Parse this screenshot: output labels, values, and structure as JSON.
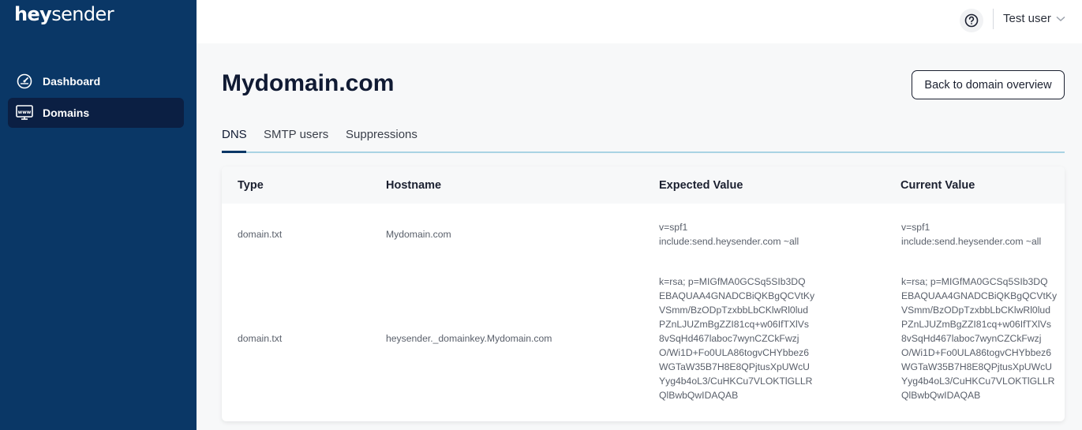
{
  "app": {
    "logo_bold": "hey",
    "logo_light": "sender"
  },
  "sidebar": {
    "items": [
      {
        "label": "Dashboard",
        "icon": "dashboard-gauge-icon",
        "active": false
      },
      {
        "label": "Domains",
        "icon": "domain-www-icon",
        "active": true
      }
    ]
  },
  "topbar": {
    "help_icon": "help-circle-icon",
    "user_name": "Test user",
    "user_chevron": "chevron-down-icon"
  },
  "page": {
    "title": "Mydomain.com",
    "back_button": "Back to domain overview"
  },
  "tabs": [
    {
      "label": "DNS",
      "active": true
    },
    {
      "label": "SMTP users",
      "active": false
    },
    {
      "label": "Suppressions",
      "active": false
    }
  ],
  "table": {
    "columns": [
      "Type",
      "Hostname",
      "Expected Value",
      "Current Value"
    ],
    "rows": [
      {
        "type": "domain.txt",
        "hostname": "Mydomain.com",
        "expected": "v=spf1\ninclude:send.heysender.com ~all",
        "current": "v=spf1\ninclude:send.heysender.com ~all"
      },
      {
        "type": "domain.txt",
        "hostname": "heysender._domainkey.Mydomain.com",
        "expected": "k=rsa; p=MIGfMA0GCSq5SIb3DQ\nEBAQUAA4GNADCBiQKBgQCVtKy\nVSmm/BzODpTzxbbLbCKlwRl0lud\nPZnLJUZmBgZZI81cq+w06IfTXlVs\n8vSqHd467laboc7wynCZCkFwzj\nO/Wi1D+Fo0ULA86togvCHYbbez6\nWGTaW35B7H8E8QPjtusXpUWcU\nYyg4b4oL3/CuHKCu7VLOKTlGLLR\nQlBwbQwIDAQAB",
        "current": "k=rsa; p=MIGfMA0GCSq5SIb3DQ\nEBAQUAA4GNADCBiQKBgQCVtKy\nVSmm/BzODpTzxbbLbCKlwRl0lud\nPZnLJUZmBgZZI81cq+w06IfTXlVs\n8vSqHd467laboc7wynCZCkFwzj\nO/Wi1D+Fo0ULA86togvCHYbbez6\nWGTaW35B7H8E8QPjtusXpUWcU\nYyg4b4oL3/CuHKCu7VLOKTlGLLR\nQlBwbQwIDAQAB"
      }
    ]
  }
}
